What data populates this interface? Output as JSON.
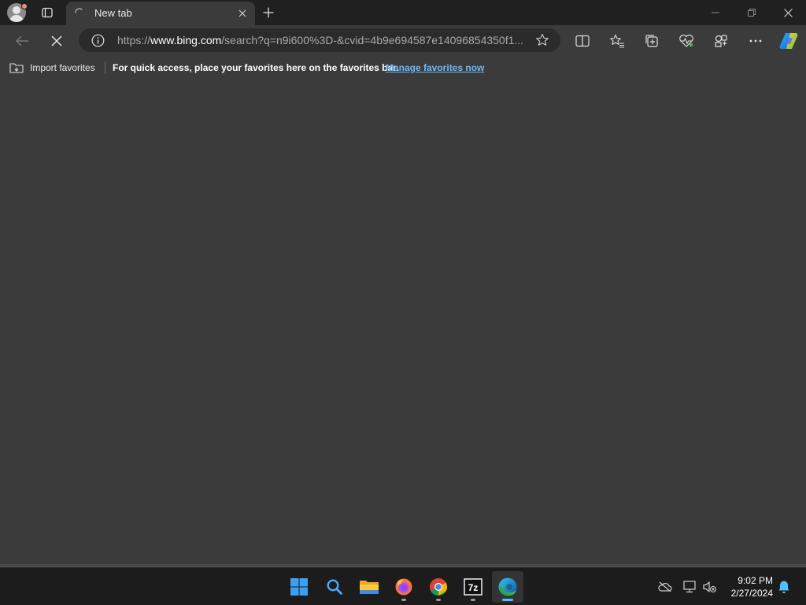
{
  "browser": {
    "tab": {
      "title": "New tab"
    },
    "address": {
      "scheme": "https://",
      "host": "www.bing.com",
      "path": "/search?q=n9i600%3D-&cvid=4b9e694587e14096854350f1..."
    },
    "favorites_bar": {
      "import_label": "Import favorites",
      "message": "For quick access, place your favorites here on the favorites bar.",
      "manage_link": "Manage favorites now"
    }
  },
  "taskbar": {
    "apps": [
      {
        "name": "start",
        "icon": "windows-start-icon"
      },
      {
        "name": "search",
        "icon": "search-icon"
      },
      {
        "name": "file-explorer",
        "icon": "folder-icon"
      },
      {
        "name": "firefox",
        "icon": "firefox-icon"
      },
      {
        "name": "chrome",
        "icon": "chrome-icon"
      },
      {
        "name": "7-zip",
        "icon": "7zip-icon",
        "label": "7z"
      },
      {
        "name": "edge",
        "icon": "edge-icon",
        "active": true
      }
    ],
    "clock": {
      "time": "9:02 PM",
      "date": "2/27/2024"
    }
  },
  "colors": {
    "accent": "#4cc2ff",
    "link": "#6cb8f6",
    "page_bg": "#3b3b3b",
    "titlebar_bg": "#202020",
    "taskbar_bg": "#1c1c1c"
  }
}
